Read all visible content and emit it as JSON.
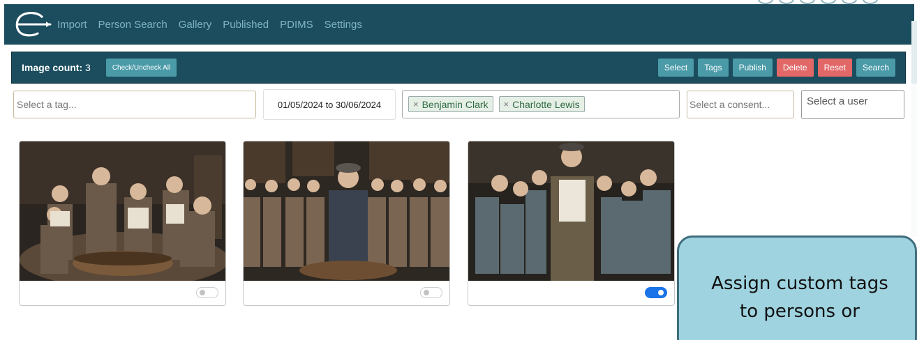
{
  "nav": {
    "items": [
      "Import",
      "Person Search",
      "Gallery",
      "Published",
      "PDIMS",
      "Settings"
    ]
  },
  "toolbar": {
    "image_count_label": "Image count:",
    "image_count_value": "3",
    "check_all_label": "Check/Uncheck All",
    "select_label": "Select",
    "tags_label": "Tags",
    "publish_label": "Publish",
    "delete_label": "Delete",
    "reset_label": "Reset",
    "search_label": "Search"
  },
  "filters": {
    "tag_placeholder": "Select a tag...",
    "date_range": "01/05/2024 to 30/06/2024",
    "persons": [
      "Benjamin Clark",
      "Charlotte Lewis"
    ],
    "consent_placeholder": "Select a consent...",
    "user_placeholder": "Select a user"
  },
  "gallery": {
    "cards": [
      {
        "published": false
      },
      {
        "published": false
      },
      {
        "published": true
      }
    ]
  },
  "callout": {
    "line1": "Assign custom tags",
    "line2": "to persons or"
  },
  "colors": {
    "navbar": "#1b4d5e",
    "nav_text": "#7fb5c2",
    "button_teal": "#4a9aa8",
    "button_red": "#e26868",
    "toggle_on": "#1a73e8",
    "callout_bg": "#9ed3df"
  },
  "icons": {
    "logo": "e-logo-icon",
    "chip_remove": "close-icon"
  }
}
